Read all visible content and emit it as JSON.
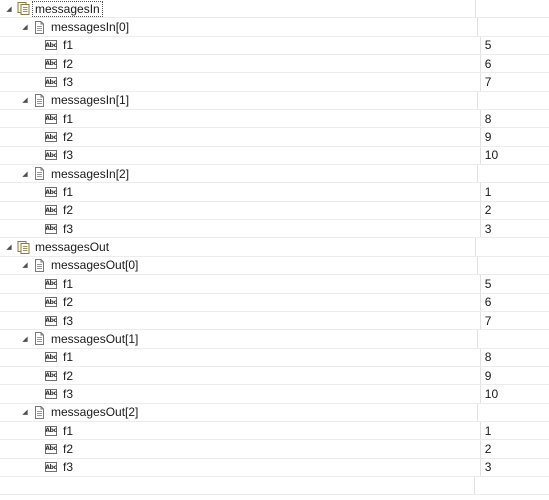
{
  "tree": {
    "groups": [
      {
        "label": "messagesIn",
        "expanded": true,
        "selected": true,
        "icon": "collection-icon",
        "children": [
          {
            "label": "messagesIn[0]",
            "icon": "document-icon",
            "fields": [
              {
                "name": "f1",
                "value": "5"
              },
              {
                "name": "f2",
                "value": "6"
              },
              {
                "name": "f3",
                "value": "7"
              }
            ]
          },
          {
            "label": "messagesIn[1]",
            "icon": "document-icon",
            "fields": [
              {
                "name": "f1",
                "value": "8"
              },
              {
                "name": "f2",
                "value": "9"
              },
              {
                "name": "f3",
                "value": "10"
              }
            ]
          },
          {
            "label": "messagesIn[2]",
            "icon": "document-icon",
            "fields": [
              {
                "name": "f1",
                "value": "1"
              },
              {
                "name": "f2",
                "value": "2"
              },
              {
                "name": "f3",
                "value": "3"
              }
            ]
          }
        ]
      },
      {
        "label": "messagesOut",
        "expanded": true,
        "selected": false,
        "icon": "collection-icon",
        "children": [
          {
            "label": "messagesOut[0]",
            "icon": "document-icon",
            "fields": [
              {
                "name": "f1",
                "value": "5"
              },
              {
                "name": "f2",
                "value": "6"
              },
              {
                "name": "f3",
                "value": "7"
              }
            ]
          },
          {
            "label": "messagesOut[1]",
            "icon": "document-icon",
            "fields": [
              {
                "name": "f1",
                "value": "8"
              },
              {
                "name": "f2",
                "value": "9"
              },
              {
                "name": "f3",
                "value": "10"
              }
            ]
          },
          {
            "label": "messagesOut[2]",
            "icon": "document-icon",
            "fields": [
              {
                "name": "f1",
                "value": "1"
              },
              {
                "name": "f2",
                "value": "2"
              },
              {
                "name": "f3",
                "value": "3"
              }
            ]
          }
        ]
      }
    ],
    "field_icon_text": "Abc",
    "field_icon_name": "abc-string-icon",
    "twisty_icon_name": "expanded-triangle-icon"
  }
}
